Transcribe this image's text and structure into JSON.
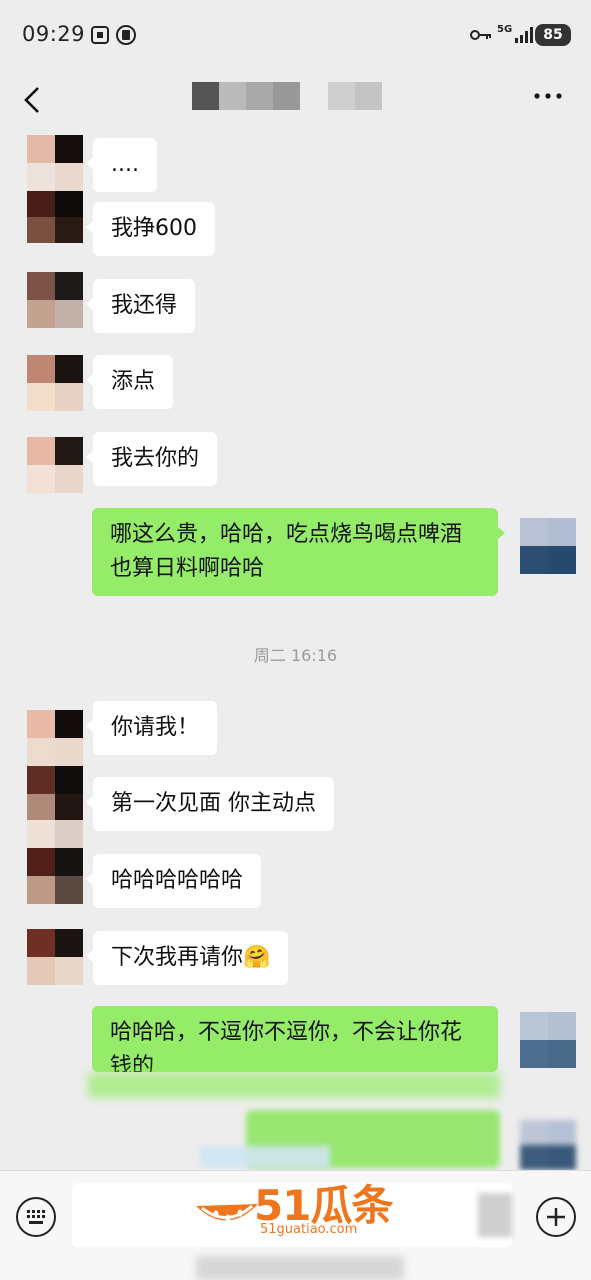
{
  "status_bar": {
    "time": "09:29",
    "network": "5G",
    "battery": "85"
  },
  "header": {
    "contact_name_redacted": true
  },
  "messages": [
    {
      "side": "left",
      "text": "...."
    },
    {
      "side": "left",
      "text": "我挣600"
    },
    {
      "side": "left",
      "text": "我还得"
    },
    {
      "side": "left",
      "text": "添点"
    },
    {
      "side": "left",
      "text": "我去你的"
    },
    {
      "side": "right",
      "text": "哪这么贵，哈哈，吃点烧鸟喝点啤酒也算日料啊哈哈"
    },
    {
      "side": "left",
      "text": "你请我！"
    },
    {
      "side": "left",
      "text": "第一次见面 你主动点"
    },
    {
      "side": "left",
      "text": "哈哈哈哈哈哈"
    },
    {
      "side": "left",
      "text": "下次我再请你",
      "emoji": "🤗"
    },
    {
      "side": "right",
      "text": "哈哈哈，不逗你不逗你，不会让你花钱的"
    }
  ],
  "time_divider": "周二 16:16",
  "watermark": {
    "brand": "51瓜条",
    "url": "51guatiao.com"
  },
  "colors": {
    "background": "#ededed",
    "bubble_self": "#95ec69",
    "bubble_other": "#ffffff",
    "watermark": "#f0761e"
  },
  "icons": [
    "back-arrow-icon",
    "more-icon",
    "keyboard-icon",
    "add-icon",
    "key-icon",
    "signal-icon",
    "battery-icon"
  ]
}
